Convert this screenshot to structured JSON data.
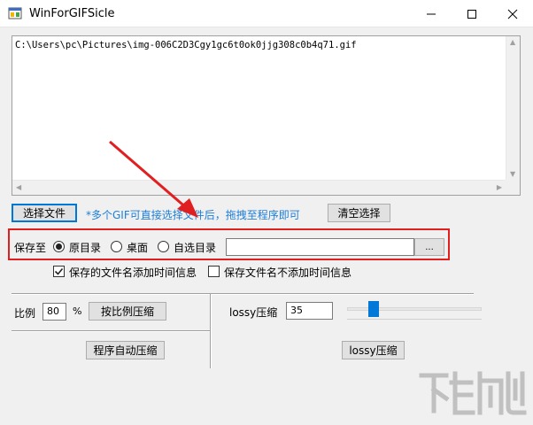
{
  "window": {
    "title": "WinForGIFSicle"
  },
  "file_list": {
    "items": [
      "C:\\Users\\pc\\Pictures\\img-006C2D3Cgy1gc6t0ok0jjg308c0b4q71.gif"
    ]
  },
  "toolbar": {
    "select_file_label": "选择文件",
    "hint_text": "*多个GIF可直接选择文件后，拖拽至程序即可",
    "clear_selection_label": "清空选择"
  },
  "save_to": {
    "label": "保存至",
    "options": [
      "原目录",
      "桌面",
      "自选目录"
    ],
    "selected": "原目录",
    "path_value": "",
    "browse_label": "..."
  },
  "options": {
    "add_time_label": "保存的文件名添加时间信息",
    "add_time_checked": true,
    "no_time_label": "保存文件名不添加时间信息",
    "no_time_checked": false
  },
  "ratio": {
    "label": "比例",
    "value": "80",
    "unit": "%",
    "compress_label": "按比例压缩",
    "auto_label": "程序自动压缩"
  },
  "lossy": {
    "label": "lossy压缩",
    "value": "35",
    "slider_fraction": 0.17,
    "compress_label": "lossy压缩"
  },
  "colors": {
    "accent": "#0078d7",
    "hint": "#1e7ed8",
    "highlight": "#e02020"
  },
  "icons": [
    "app-icon",
    "minimize-icon",
    "maximize-icon",
    "close-icon",
    "arrow-annotation-icon"
  ]
}
